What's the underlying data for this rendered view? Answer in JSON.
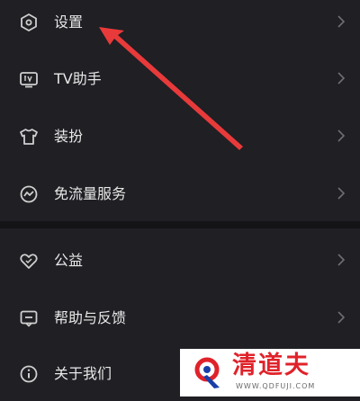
{
  "menu_top": [
    {
      "label": "设置",
      "icon": "settings-hexagon-icon"
    },
    {
      "label": "TV助手",
      "icon": "tv-icon"
    },
    {
      "label": "装扮",
      "icon": "tshirt-icon"
    },
    {
      "label": "免流量服务",
      "icon": "data-free-icon"
    }
  ],
  "menu_bottom": [
    {
      "label": "公益",
      "icon": "heart-icon"
    },
    {
      "label": "帮助与反馈",
      "icon": "feedback-icon"
    },
    {
      "label": "关于我们",
      "icon": "info-icon"
    }
  ],
  "chevron_icon": "chevron-right-icon",
  "annotation": {
    "color": "#e83a3a"
  },
  "watermark": {
    "name": "清道夫",
    "url": "WWW.QDFUJI.COM",
    "color": "#e0222a"
  },
  "colors": {
    "background": "#1f1f24",
    "separator": "#141417",
    "text": "#e8e8e8",
    "icon": "#cfcfcf",
    "chevron": "#6e6e74"
  }
}
